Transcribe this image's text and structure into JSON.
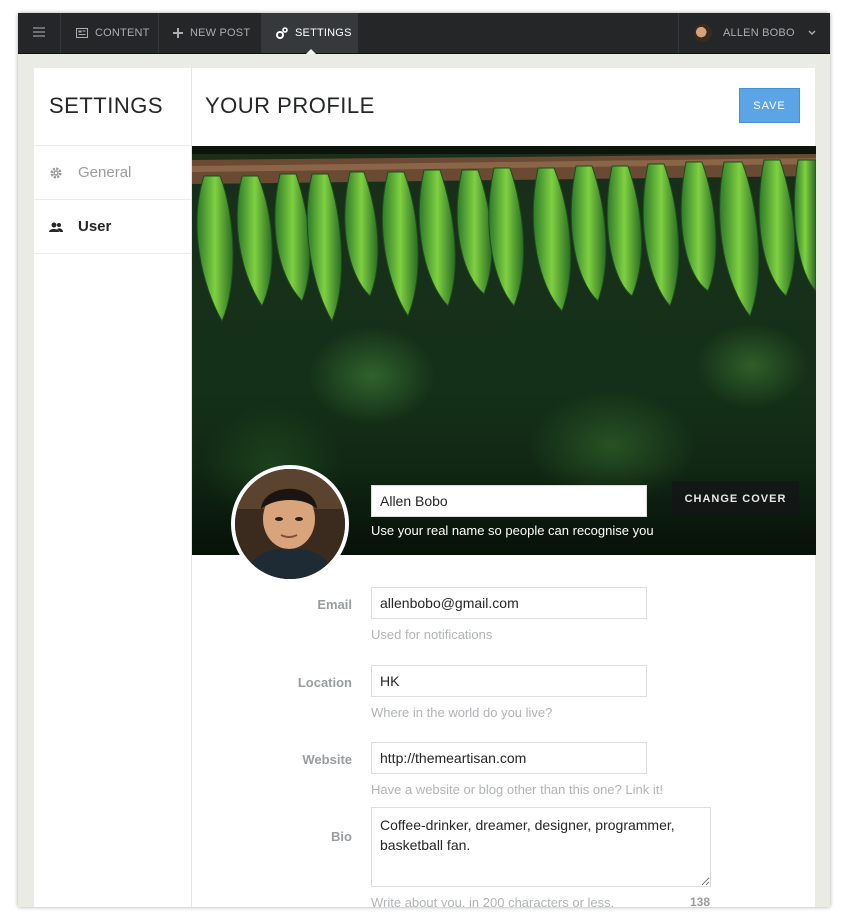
{
  "topnav": {
    "content_label": "CONTENT",
    "new_post_label": "NEW POST",
    "settings_label": "SETTINGS",
    "user_name": "ALLEN BOBO"
  },
  "sidebar": {
    "title": "SETTINGS",
    "items": [
      {
        "label": "General",
        "icon": "gear-icon",
        "active": false
      },
      {
        "label": "User",
        "icon": "users-icon",
        "active": true
      }
    ]
  },
  "main": {
    "title": "YOUR PROFILE",
    "save_label": "SAVE",
    "change_cover_label": "CHANGE COVER",
    "name_value": "Allen Bobo",
    "name_hint": "Use your real name so people can recognise you",
    "fields": {
      "email": {
        "label": "Email",
        "value": "allenbobo@gmail.com",
        "hint": "Used for notifications"
      },
      "location": {
        "label": "Location",
        "value": "HK",
        "hint": "Where in the world do you live?"
      },
      "website": {
        "label": "Website",
        "value": "http://themeartisan.com",
        "hint": "Have a website or blog other than this one? Link it!"
      },
      "bio": {
        "label": "Bio",
        "value": "Coffee-drinker, dreamer, designer, programmer, basketball fan.",
        "hint": "Write about you, in 200 characters or less.",
        "count": "138"
      }
    }
  },
  "colors": {
    "topbar": "#242628",
    "accent": "#5ba4e5",
    "panel_bg": "#ebebe6"
  }
}
